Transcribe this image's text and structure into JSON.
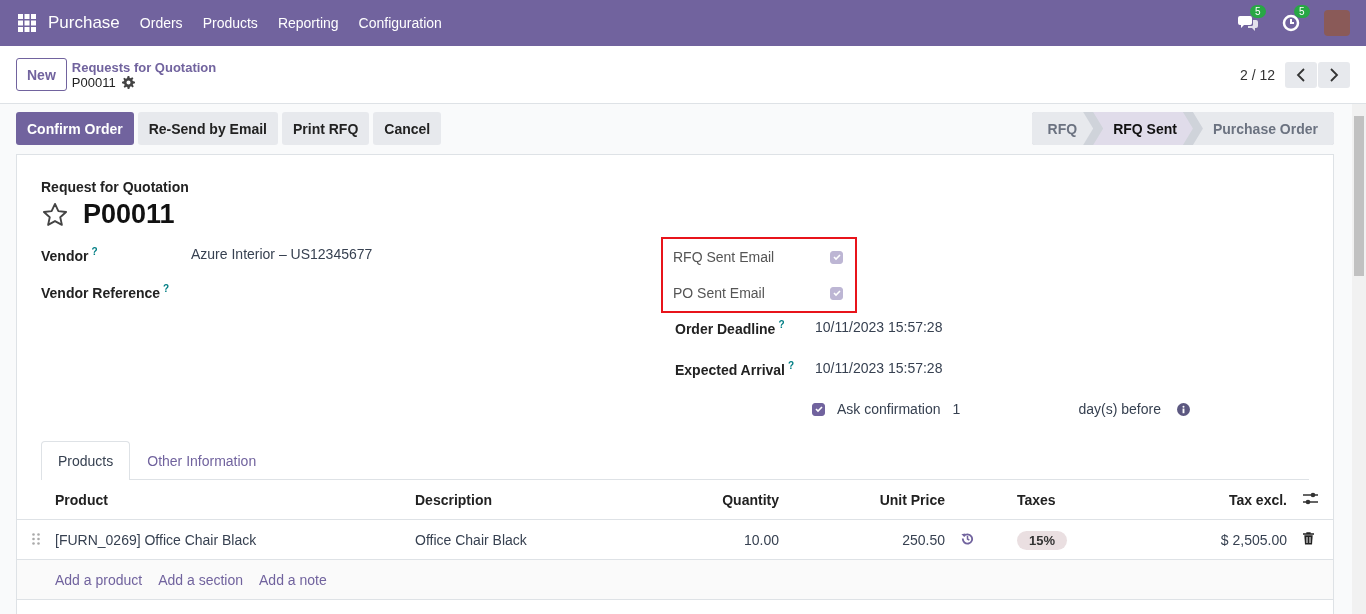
{
  "navbar": {
    "app_name": "Purchase",
    "menu": [
      "Orders",
      "Products",
      "Reporting",
      "Configuration"
    ],
    "indicators": [
      {
        "kind": "chat",
        "count": "5"
      },
      {
        "kind": "activity",
        "count": "5"
      }
    ]
  },
  "control_panel": {
    "new_button": "New",
    "breadcrumb": "Requests for Quotation",
    "record_name": "P00011",
    "pager": "2 / 12"
  },
  "actions": [
    {
      "label": "Confirm Order",
      "primary": true
    },
    {
      "label": "Re-Send by Email",
      "primary": false
    },
    {
      "label": "Print RFQ",
      "primary": false
    },
    {
      "label": "Cancel",
      "primary": false
    }
  ],
  "statusbar": [
    {
      "label": "RFQ",
      "selected": false
    },
    {
      "label": "RFQ Sent",
      "selected": true
    },
    {
      "label": "Purchase Order",
      "selected": false
    }
  ],
  "form": {
    "title_label": "Request for Quotation",
    "record_name": "P00011",
    "starred": false,
    "left_fields": [
      {
        "label": "Vendor",
        "help": "?",
        "value": "Azure Interior – US12345677"
      },
      {
        "label": "Vendor Reference",
        "help": "?"
      }
    ],
    "email_flags": [
      {
        "label": "RFQ Sent Email",
        "checked": true
      },
      {
        "label": "PO Sent Email",
        "checked": true
      }
    ],
    "right_fields": [
      {
        "label": "Order Deadline",
        "help": "?",
        "value": "10/11/2023 15:57:28"
      },
      {
        "label": "Expected Arrival",
        "help": "?",
        "value": "10/11/2023 15:57:28"
      }
    ],
    "ask_confirmation": {
      "checked": true,
      "label": "Ask confirmation",
      "days": "1",
      "suffix": "day(s) before"
    }
  },
  "tabs": [
    {
      "label": "Products",
      "selected": true
    },
    {
      "label": "Other Information",
      "selected": false
    }
  ],
  "table": {
    "columns": [
      "Product",
      "Description",
      "Quantity",
      "Unit Price",
      "Taxes",
      "Tax excl."
    ],
    "rows": [
      {
        "product": "[FURN_0269] Office Chair Black",
        "description": "Office Chair Black",
        "quantity": "10.00",
        "unit_price": "250.50",
        "taxes": "15%",
        "subtotal": "$ 2,505.00"
      }
    ],
    "add_links": [
      "Add a product",
      "Add a section",
      "Add a note"
    ]
  }
}
